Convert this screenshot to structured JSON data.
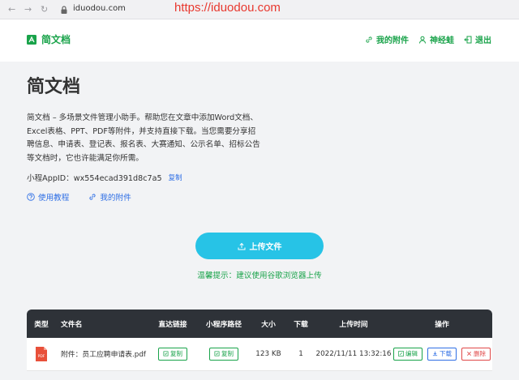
{
  "browser": {
    "url": "iduodou.com",
    "watermark": "https://iduodou.com"
  },
  "header": {
    "brand_name": "简文档",
    "links": [
      {
        "label": "我的附件",
        "icon": "link-icon"
      },
      {
        "label": "神经蛙",
        "icon": "user-icon"
      },
      {
        "label": "退出",
        "icon": "logout-icon"
      }
    ]
  },
  "main": {
    "title": "简文档",
    "intro": "简文档 – 多场景文件管理小助手。帮助您在文章中添加Word文档、Excel表格、PPT、PDF等附件，并支持直接下载。当您需要分享招聘信息、申请表、登记表、报名表、大赛通知、公示名单、招标公告等文档时，它也许能满足你所需。",
    "appid_label": "小程AppID：wx554ecad391d8c7a5",
    "appid_copy": "复制",
    "quick_links": [
      {
        "label": "使用教程",
        "icon": "question-icon"
      },
      {
        "label": "我的附件",
        "icon": "link-icon"
      }
    ],
    "upload_label": "上传文件",
    "tip": "温馨提示：建议使用谷歌浏览器上传"
  },
  "table": {
    "headers": [
      "类型",
      "文件名",
      "直达链接",
      "小程序路径",
      "大小",
      "下载",
      "上传时间",
      "操作"
    ],
    "rows": [
      {
        "type": "PDF",
        "filename": "附件：员工应聘申请表.pdf",
        "link_copy": "复制",
        "path_copy": "复制",
        "size": "123 KB",
        "downloads": "1",
        "uploaded": "2022/11/11 13:32:16",
        "edit": "编辑",
        "download": "下载",
        "delete": "删除"
      }
    ]
  },
  "colors": {
    "accent_green": "#19a34a",
    "link_blue": "#2f6fe5",
    "upload_cyan": "#27c3e6",
    "table_header": "#2e3238",
    "danger_red": "#e04848"
  }
}
